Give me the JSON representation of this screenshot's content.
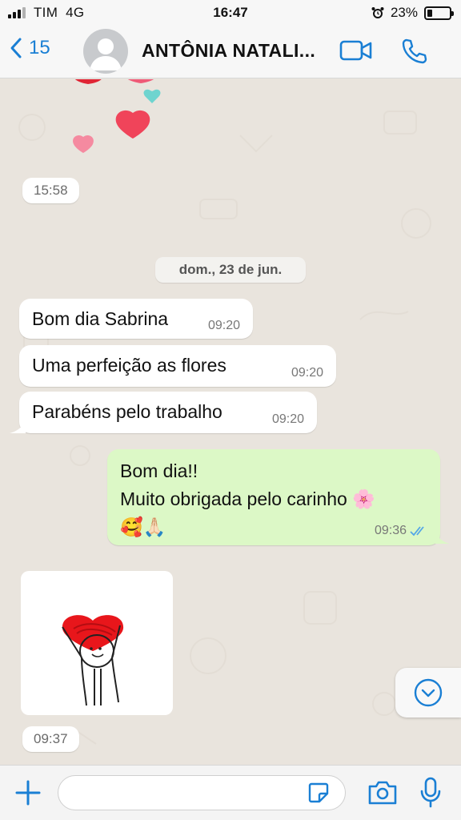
{
  "status_bar": {
    "carrier": "TIM",
    "network": "4G",
    "time": "16:47",
    "battery": "23%",
    "battery_level": 0.23
  },
  "header": {
    "back_count": "15",
    "contact_name": "ANTÔNIA NATALI..."
  },
  "chat": {
    "sticker_time": "15:58",
    "date_chip": "dom., 23 de jun.",
    "incoming": [
      {
        "text": "Bom dia Sabrina",
        "time": "09:20"
      },
      {
        "text": "Uma perfeição as flores",
        "time": "09:20"
      },
      {
        "text": "Parabéns pelo trabalho",
        "time": "09:20"
      }
    ],
    "outgoing": {
      "text": "Bom dia!!\nMuito obrigada pelo carinho 🌸\n🥰🙏🏻",
      "time": "09:36"
    },
    "image_time": "09:37"
  },
  "input": {
    "placeholder": ""
  },
  "icons": {
    "back": "chevron-left-icon",
    "avatar": "default-avatar-icon",
    "video": "video-camera-icon",
    "call": "phone-icon",
    "plus": "plus-icon",
    "sticker": "sticker-icon",
    "camera": "camera-icon",
    "mic": "microphone-icon",
    "scroll": "chevron-down-circle-icon",
    "alarm": "alarm-clock-icon"
  },
  "colors": {
    "accent": "#1a7fd4",
    "outgoing_bubble": "#dcf8c6",
    "incoming_bubble": "#ffffff",
    "chat_bg": "#e9e4dd",
    "read_ticks": "#53a6e7"
  }
}
